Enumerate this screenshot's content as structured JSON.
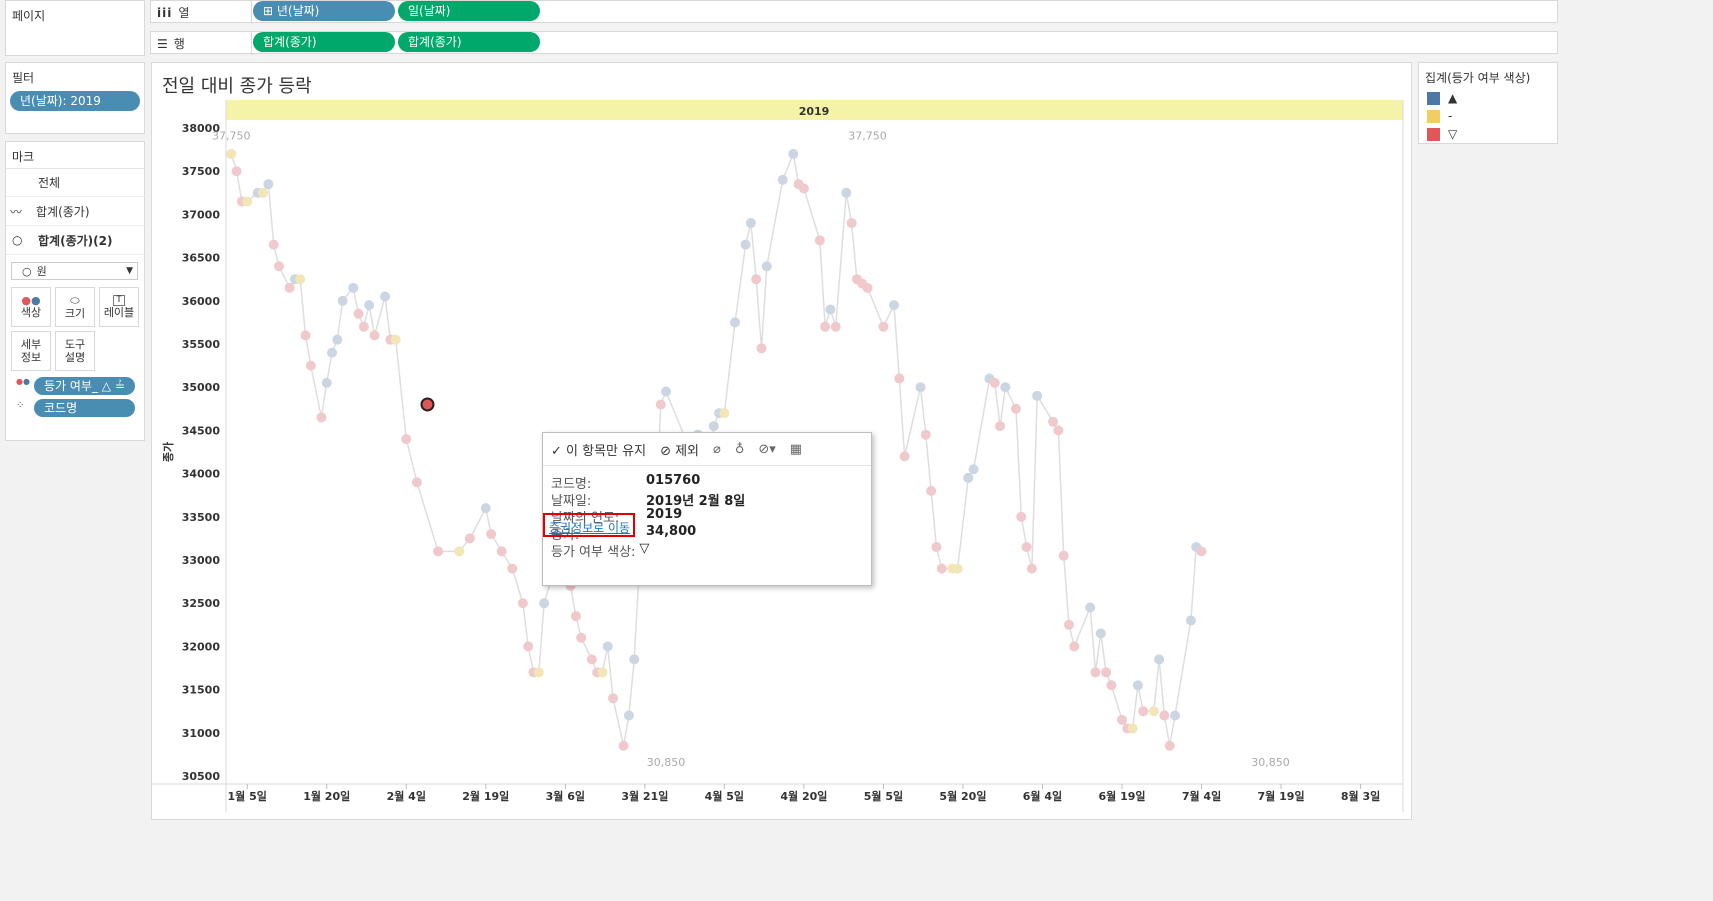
{
  "shelves": {
    "pages_label": "페이지",
    "columns_label": "열",
    "rows_label": "행",
    "columns": [
      "⊞ 년(날짜)",
      "일(날짜)"
    ],
    "rows": [
      "합계(종가)",
      "합계(종가)"
    ]
  },
  "filters": {
    "title": "필터",
    "items": [
      "년(날짜): 2019"
    ]
  },
  "marks": {
    "title": "마크",
    "all_label": "전체",
    "layer1_label": "합계(종가)",
    "layer2_label": "합계(종가)(2)",
    "mark_type": "원",
    "buttons": {
      "color": "색상",
      "size": "크기",
      "label": "레이블",
      "detail_l1": "세부",
      "detail_l2": "정보",
      "tooltip_l1": "도구",
      "tooltip_l2": "설명"
    },
    "pills": [
      "등가 여부_ △ ≟",
      "코드명"
    ]
  },
  "legend": {
    "title": "집계(등가 여부 색상)",
    "items": [
      {
        "label": "▲",
        "color": "#4e79a7"
      },
      {
        "label": "-",
        "color": "#f1ce63"
      },
      {
        "label": "▽",
        "color": "#e15759"
      }
    ]
  },
  "sheet_title": "전일 대비 종가 등락",
  "year_header": "2019",
  "tooltip": {
    "keep_only": "✓ 이 항목만 유지",
    "exclude": "⊘ 제외",
    "fields": [
      {
        "k": "코드명:",
        "v": "015760"
      },
      {
        "k": "날짜일:",
        "v": "2019년 2월 8일"
      },
      {
        "k": "날짜의 연도:",
        "v": "2019"
      },
      {
        "k": "종가:",
        "v": "34,800"
      },
      {
        "k": "등가 여부 색상:",
        "v": "▽"
      }
    ],
    "link": "증권정보로 이동"
  },
  "chart_data": {
    "type": "line",
    "title": "전일 대비 종가 등락",
    "ylabel": "종가",
    "ylim": [
      30500,
      38000
    ],
    "yticks": [
      30500,
      31000,
      31500,
      32000,
      32500,
      33000,
      33500,
      34000,
      34500,
      35000,
      35500,
      36000,
      36500,
      37000,
      37500,
      38000
    ],
    "xlim_day": [
      0,
      222
    ],
    "xticks": [
      {
        "day": 4,
        "label": "1월 5일"
      },
      {
        "day": 19,
        "label": "1월 20일"
      },
      {
        "day": 34,
        "label": "2월 4일"
      },
      {
        "day": 49,
        "label": "2월 19일"
      },
      {
        "day": 64,
        "label": "3월 6일"
      },
      {
        "day": 79,
        "label": "3월 21일"
      },
      {
        "day": 94,
        "label": "4월 5일"
      },
      {
        "day": 109,
        "label": "4월 20일"
      },
      {
        "day": 124,
        "label": "5월 5일"
      },
      {
        "day": 139,
        "label": "5월 20일"
      },
      {
        "day": 154,
        "label": "6월 4일"
      },
      {
        "day": 169,
        "label": "6월 19일"
      },
      {
        "day": 184,
        "label": "7월 4일"
      },
      {
        "day": 199,
        "label": "7월 19일"
      },
      {
        "day": 214,
        "label": "8월 3일"
      }
    ],
    "annotations": [
      {
        "day": 1,
        "value": 37750,
        "label": "37,750"
      },
      {
        "day": 121,
        "value": 37750,
        "label": "37,750"
      },
      {
        "day": 83,
        "value": 30850,
        "label": "30,850"
      },
      {
        "day": 197,
        "value": 30850,
        "label": "30,850"
      }
    ],
    "highlight": {
      "day": 38,
      "value": 34800
    },
    "points": [
      [
        1,
        37700,
        "s"
      ],
      [
        2,
        37500,
        "d"
      ],
      [
        3,
        37150,
        "d"
      ],
      [
        4,
        37150,
        "s"
      ],
      [
        6,
        37250,
        "u"
      ],
      [
        7,
        37250,
        "s"
      ],
      [
        8,
        37350,
        "u"
      ],
      [
        9,
        36650,
        "d"
      ],
      [
        10,
        36400,
        "d"
      ],
      [
        12,
        36150,
        "d"
      ],
      [
        13,
        36250,
        "u"
      ],
      [
        14,
        36250,
        "s"
      ],
      [
        15,
        35600,
        "d"
      ],
      [
        16,
        35250,
        "d"
      ],
      [
        18,
        34650,
        "d"
      ],
      [
        19,
        35050,
        "u"
      ],
      [
        20,
        35400,
        "u"
      ],
      [
        21,
        35550,
        "u"
      ],
      [
        22,
        36000,
        "u"
      ],
      [
        24,
        36150,
        "u"
      ],
      [
        25,
        35850,
        "d"
      ],
      [
        26,
        35700,
        "d"
      ],
      [
        27,
        35950,
        "u"
      ],
      [
        28,
        35600,
        "d"
      ],
      [
        30,
        36050,
        "u"
      ],
      [
        31,
        35550,
        "d"
      ],
      [
        32,
        35550,
        "s"
      ],
      [
        34,
        34400,
        "d"
      ],
      [
        36,
        33900,
        "d"
      ],
      [
        40,
        33100,
        "d"
      ],
      [
        44,
        33100,
        "s"
      ],
      [
        46,
        33250,
        "d"
      ],
      [
        49,
        33600,
        "u"
      ],
      [
        50,
        33300,
        "d"
      ],
      [
        52,
        33100,
        "d"
      ],
      [
        54,
        32900,
        "d"
      ],
      [
        56,
        32500,
        "d"
      ],
      [
        57,
        32000,
        "d"
      ],
      [
        58,
        31700,
        "d"
      ],
      [
        59,
        31700,
        "s"
      ],
      [
        60,
        32500,
        "u"
      ],
      [
        63,
        33100,
        "u"
      ],
      [
        64,
        32850,
        "d"
      ],
      [
        65,
        32700,
        "d"
      ],
      [
        66,
        32350,
        "d"
      ],
      [
        67,
        32100,
        "d"
      ],
      [
        69,
        31850,
        "d"
      ],
      [
        70,
        31700,
        "d"
      ],
      [
        71,
        31700,
        "s"
      ],
      [
        72,
        32000,
        "u"
      ],
      [
        73,
        31400,
        "d"
      ],
      [
        75,
        30850,
        "d"
      ],
      [
        76,
        31200,
        "u"
      ],
      [
        77,
        31850,
        "u"
      ],
      [
        78,
        32950,
        "u"
      ],
      [
        79,
        32850,
        "d"
      ],
      [
        81,
        33250,
        "u"
      ],
      [
        82,
        34800,
        "d"
      ],
      [
        83,
        34950,
        "u"
      ],
      [
        88,
        34200,
        "d"
      ],
      [
        89,
        34450,
        "u"
      ],
      [
        91,
        33750,
        "d"
      ],
      [
        92,
        34550,
        "u"
      ],
      [
        93,
        34700,
        "u"
      ],
      [
        94,
        34700,
        "s"
      ],
      [
        96,
        35750,
        "u"
      ],
      [
        98,
        36650,
        "u"
      ],
      [
        99,
        36900,
        "u"
      ],
      [
        100,
        36250,
        "d"
      ],
      [
        101,
        35450,
        "d"
      ],
      [
        102,
        36400,
        "u"
      ],
      [
        105,
        37400,
        "u"
      ],
      [
        107,
        37700,
        "u"
      ],
      [
        108,
        37350,
        "d"
      ],
      [
        109,
        37300,
        "d"
      ],
      [
        112,
        36700,
        "d"
      ],
      [
        113,
        35700,
        "d"
      ],
      [
        114,
        35900,
        "u"
      ],
      [
        115,
        35700,
        "d"
      ],
      [
        117,
        37250,
        "u"
      ],
      [
        118,
        36900,
        "d"
      ],
      [
        119,
        36250,
        "d"
      ],
      [
        120,
        36200,
        "d"
      ],
      [
        121,
        36150,
        "d"
      ],
      [
        124,
        35700,
        "d"
      ],
      [
        126,
        35950,
        "u"
      ],
      [
        127,
        35100,
        "d"
      ],
      [
        128,
        34200,
        "d"
      ],
      [
        131,
        35000,
        "u"
      ],
      [
        132,
        34450,
        "d"
      ],
      [
        133,
        33800,
        "d"
      ],
      [
        134,
        33150,
        "d"
      ],
      [
        135,
        32900,
        "d"
      ],
      [
        137,
        32900,
        "s"
      ],
      [
        138,
        32900,
        "s"
      ],
      [
        140,
        33950,
        "u"
      ],
      [
        141,
        34050,
        "u"
      ],
      [
        144,
        35100,
        "u"
      ],
      [
        145,
        35050,
        "d"
      ],
      [
        146,
        34550,
        "d"
      ],
      [
        147,
        35000,
        "u"
      ],
      [
        149,
        34750,
        "d"
      ],
      [
        150,
        33500,
        "d"
      ],
      [
        151,
        33150,
        "d"
      ],
      [
        152,
        32900,
        "d"
      ],
      [
        153,
        34900,
        "u"
      ],
      [
        156,
        34600,
        "d"
      ],
      [
        157,
        34500,
        "d"
      ],
      [
        158,
        33050,
        "d"
      ],
      [
        159,
        32250,
        "d"
      ],
      [
        160,
        32000,
        "d"
      ],
      [
        163,
        32450,
        "u"
      ],
      [
        164,
        31700,
        "d"
      ],
      [
        165,
        32150,
        "u"
      ],
      [
        166,
        31700,
        "d"
      ],
      [
        167,
        31550,
        "d"
      ],
      [
        169,
        31150,
        "d"
      ],
      [
        170,
        31050,
        "d"
      ],
      [
        171,
        31050,
        "s"
      ],
      [
        172,
        31550,
        "u"
      ],
      [
        173,
        31250,
        "d"
      ],
      [
        175,
        31250,
        "s"
      ],
      [
        176,
        31850,
        "u"
      ],
      [
        177,
        31200,
        "d"
      ],
      [
        178,
        30850,
        "d"
      ],
      [
        179,
        31200,
        "u"
      ],
      [
        182,
        32300,
        "u"
      ],
      [
        183,
        33150,
        "u"
      ],
      [
        184,
        33100,
        "d"
      ]
    ]
  }
}
